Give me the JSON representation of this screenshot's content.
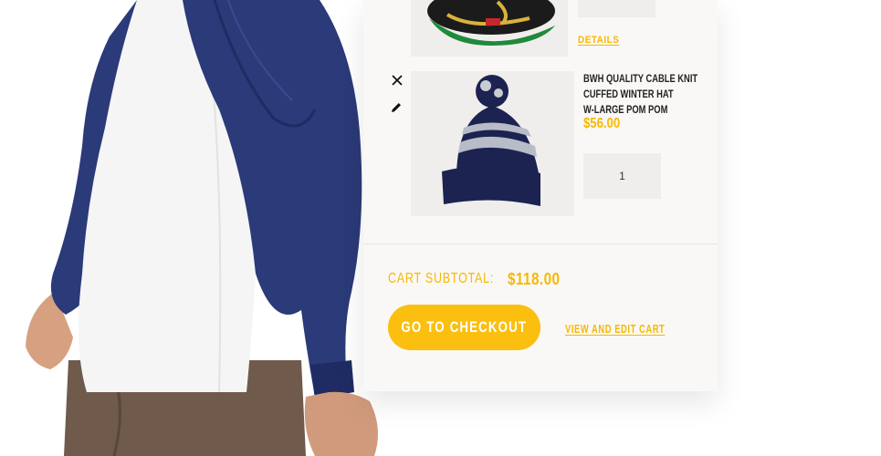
{
  "cart": {
    "items": [
      {
        "image_icon": "snapback-cap",
        "quantity": "",
        "details_label": "DETAILS"
      },
      {
        "image_icon": "pom-pom-beanie",
        "name_line1": "BWH QUALITY CABLE KNIT",
        "name_line2": "CUFFED WINTER HAT",
        "name_line3": "W-LARGE POM POM",
        "price": "$56.00",
        "quantity": "1",
        "remove_icon": "close-icon",
        "edit_icon": "pencil-icon"
      }
    ],
    "subtotal_label": "CART SUBTOTAL:",
    "subtotal_value": "$118.00",
    "checkout_label": "GO TO CHECKOUT",
    "edit_cart_label": "VIEW AND EDIT CART"
  },
  "colors": {
    "accent": "#f6b800",
    "button": "#fbbf0f",
    "panel": "#faf8f7",
    "jacket": "#2b3a78"
  }
}
